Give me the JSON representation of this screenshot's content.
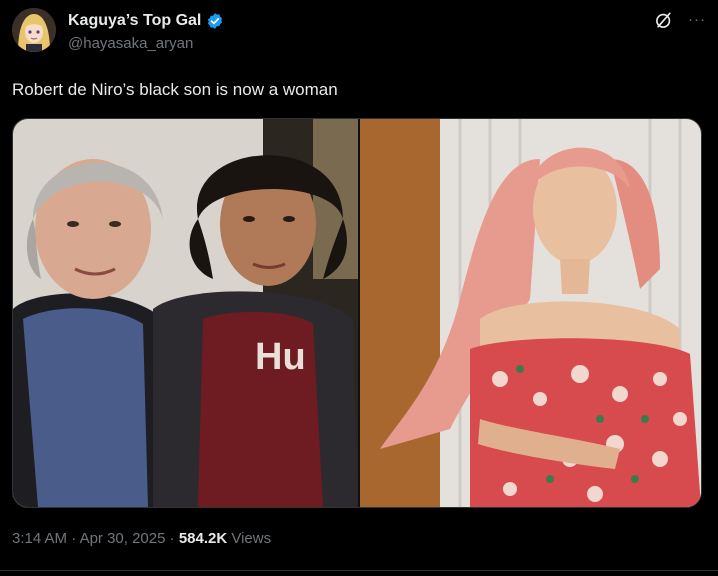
{
  "author": {
    "display_name": "Kaguya’s Top Gal",
    "handle": "@hayasaka_aryan",
    "verified": true,
    "avatar_icon": "anime-avatar"
  },
  "header_icons": [
    "grok-icon",
    "more-icon"
  ],
  "more_label": "···",
  "post": {
    "text": "Robert de Niro’s black son is now a woman"
  },
  "media": {
    "images": [
      {
        "name": "photo-left",
        "description_icon": "photo"
      },
      {
        "name": "photo-right",
        "description_icon": "photo"
      }
    ],
    "shirt_text": "Hu"
  },
  "meta": {
    "time": "3:14 AM",
    "separator": " · ",
    "date": "Apr 30, 2025",
    "views_count": "584.2K",
    "views_label": " Views"
  },
  "colors": {
    "background": "#000000",
    "text": "#e7e9ea",
    "muted": "#71767b",
    "verified": "#1d9bf0"
  }
}
